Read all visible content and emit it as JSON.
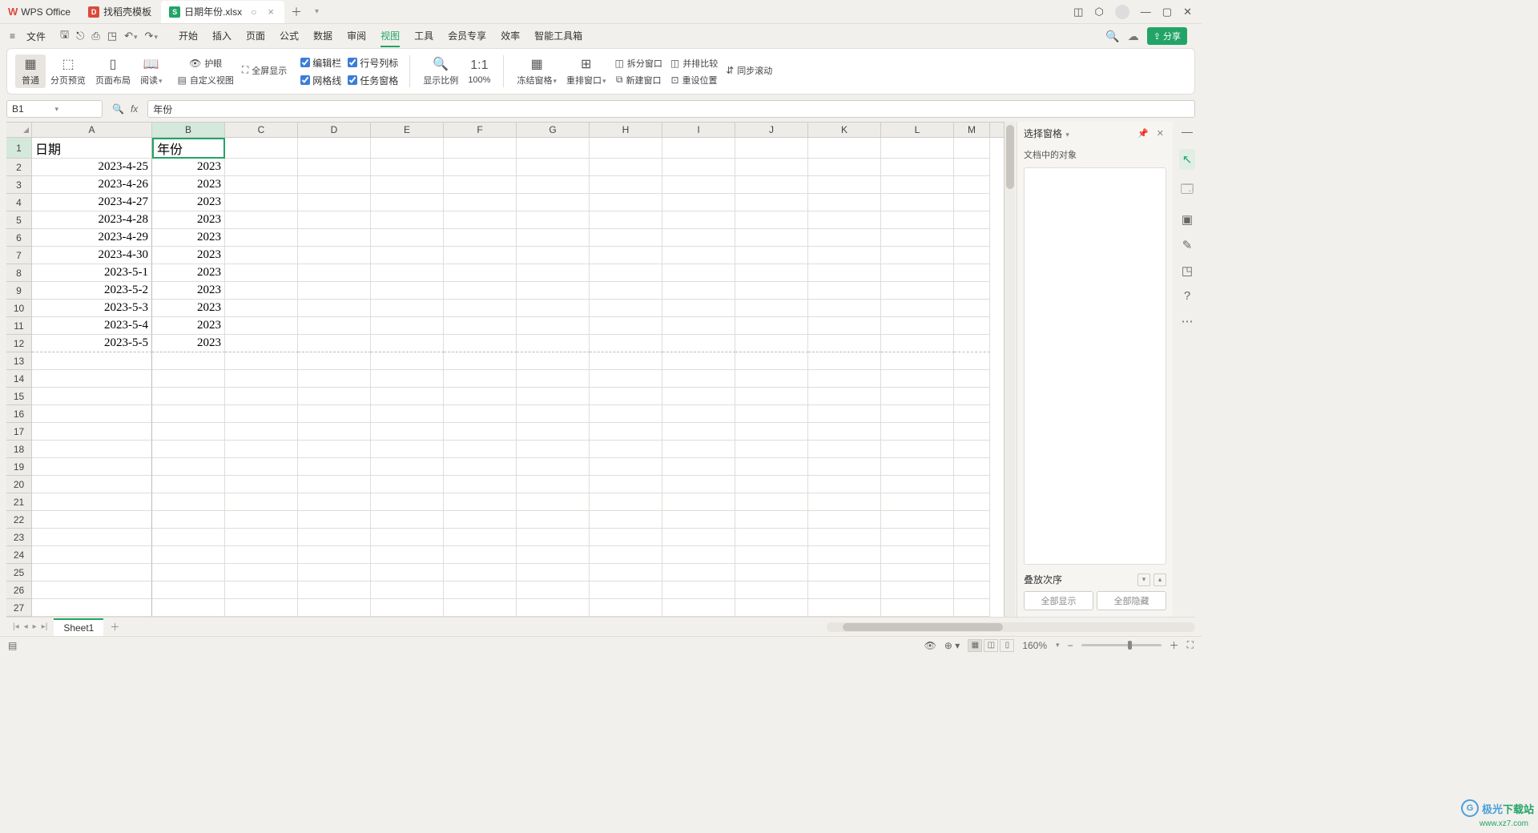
{
  "app": {
    "name": "WPS Office"
  },
  "tabs": {
    "template_tab": "找稻壳模板",
    "file_tab": "日期年份.xlsx"
  },
  "menu": {
    "file": "文件",
    "items": [
      "开始",
      "插入",
      "页面",
      "公式",
      "数据",
      "审阅",
      "视图",
      "工具",
      "会员专享",
      "效率",
      "智能工具箱"
    ],
    "active": "视图",
    "share": "分享"
  },
  "ribbon": {
    "normal": "普通",
    "page_preview": "分页预览",
    "page_layout": "页面布局",
    "read": "阅读",
    "eye_protect": "护眼",
    "fullscreen": "全屏显示",
    "custom_view": "自定义视图",
    "edit_bar": "编辑栏",
    "row_col_label": "行号列标",
    "gridlines": "网格线",
    "task_pane": "任务窗格",
    "show_scale": "显示比例",
    "pct100": "100%",
    "freeze": "冻结窗格",
    "arrange": "重排窗口",
    "split": "拆分窗口",
    "new_window": "新建窗口",
    "side_by_side": "并排比较",
    "sync_scroll": "同步滚动",
    "reset_pos": "重设位置"
  },
  "formula_bar": {
    "cell_ref": "B1",
    "value": "年份",
    "ghost": ""
  },
  "columns": [
    "A",
    "B",
    "C",
    "D",
    "E",
    "F",
    "G",
    "H",
    "I",
    "J",
    "K",
    "L",
    "M"
  ],
  "grid": {
    "headers": {
      "A": "日期",
      "B": "年份"
    },
    "rows": [
      {
        "A": "2023-4-25",
        "B": "2023"
      },
      {
        "A": "2023-4-26",
        "B": "2023"
      },
      {
        "A": "2023-4-27",
        "B": "2023"
      },
      {
        "A": "2023-4-28",
        "B": "2023"
      },
      {
        "A": "2023-4-29",
        "B": "2023"
      },
      {
        "A": "2023-4-30",
        "B": "2023"
      },
      {
        "A": "2023-5-1",
        "B": "2023"
      },
      {
        "A": "2023-5-2",
        "B": "2023"
      },
      {
        "A": "2023-5-3",
        "B": "2023"
      },
      {
        "A": "2023-5-4",
        "B": "2023"
      },
      {
        "A": "2023-5-5",
        "B": "2023"
      }
    ],
    "total_visible_rows": 27
  },
  "side_panel": {
    "title": "选择窗格",
    "subtitle": "文档中的对象",
    "stack_order": "叠放次序",
    "show_all": "全部显示",
    "hide_all": "全部隐藏"
  },
  "sheet_tabs": {
    "sheet1": "Sheet1"
  },
  "status": {
    "zoom": "160%"
  },
  "watermark": {
    "text1": "极光",
    "text2": "下载站",
    "url": "www.xz7.com"
  }
}
